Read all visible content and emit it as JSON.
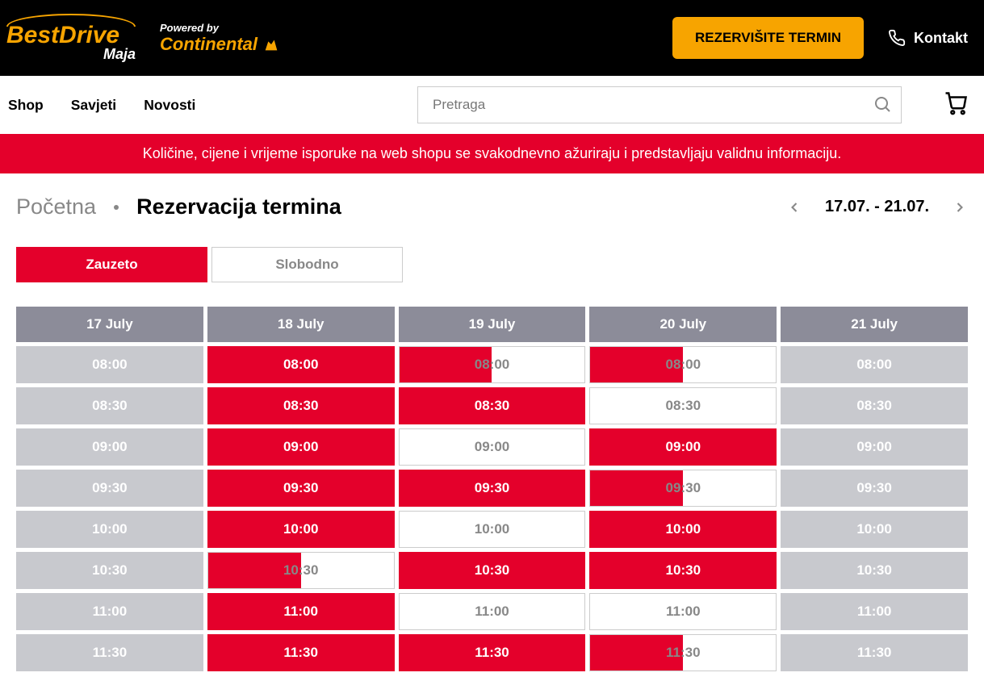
{
  "header": {
    "logo_main": "BestDrive",
    "logo_sub": "Maja",
    "powered": "Powered by",
    "continental": "Continental",
    "reserve_btn": "REZERVIŠITE TERMIN",
    "contact": "Kontakt"
  },
  "nav": {
    "links": [
      "Shop",
      "Savjeti",
      "Novosti"
    ],
    "search_placeholder": "Pretraga"
  },
  "banner": "Količine, cijene i vrijeme isporuke na web shopu se svakodnevno ažuriraju i predstavljaju validnu informaciju.",
  "breadcrumb": {
    "home": "Početna",
    "title": "Rezervacija termina",
    "range": "17.07. - 21.07."
  },
  "legend": {
    "busy": "Zauzeto",
    "free": "Slobodno"
  },
  "schedule": {
    "days": [
      "17 July",
      "18 July",
      "19 July",
      "20 July",
      "21 July"
    ],
    "times": [
      "08:00",
      "08:30",
      "09:00",
      "09:30",
      "10:00",
      "10:30",
      "11:00",
      "11:30"
    ],
    "cells": [
      [
        {
          "s": "past"
        },
        {
          "s": "past"
        },
        {
          "s": "past"
        },
        {
          "s": "past"
        },
        {
          "s": "past"
        },
        {
          "s": "past"
        },
        {
          "s": "past"
        },
        {
          "s": "past"
        }
      ],
      [
        {
          "s": "busy"
        },
        {
          "s": "busy"
        },
        {
          "s": "busy"
        },
        {
          "s": "busy"
        },
        {
          "s": "busy"
        },
        {
          "s": "partial",
          "f": 50
        },
        {
          "s": "busy"
        },
        {
          "s": "busy"
        }
      ],
      [
        {
          "s": "partial",
          "f": 50
        },
        {
          "s": "busy"
        },
        {
          "s": "free"
        },
        {
          "s": "busy"
        },
        {
          "s": "free"
        },
        {
          "s": "busy"
        },
        {
          "s": "free"
        },
        {
          "s": "busy"
        }
      ],
      [
        {
          "s": "partial",
          "f": 50
        },
        {
          "s": "free"
        },
        {
          "s": "busy"
        },
        {
          "s": "partial",
          "f": 50
        },
        {
          "s": "busy"
        },
        {
          "s": "busy"
        },
        {
          "s": "free"
        },
        {
          "s": "partial",
          "f": 50
        }
      ],
      [
        {
          "s": "past"
        },
        {
          "s": "past"
        },
        {
          "s": "past"
        },
        {
          "s": "past"
        },
        {
          "s": "past"
        },
        {
          "s": "past"
        },
        {
          "s": "past"
        },
        {
          "s": "past"
        }
      ]
    ]
  }
}
